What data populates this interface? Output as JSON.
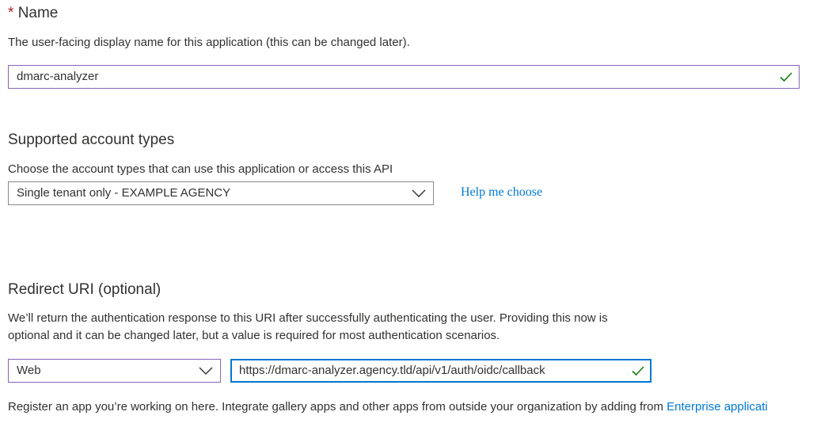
{
  "name_section": {
    "required_marker": "*",
    "heading": "Name",
    "description": "The user-facing display name for this application (this can be changed later).",
    "input_value": "dmarc-analyzer",
    "valid_icon": "check-icon"
  },
  "account_types": {
    "heading": "Supported account types",
    "description": "Choose the account types that can use this application or access this API",
    "selected": "Single tenant only - EXAMPLE AGENCY",
    "dropdown_icon": "chevron-down-icon",
    "help_link": "Help me choose"
  },
  "redirect_uri": {
    "heading": "Redirect URI (optional)",
    "description_line1": "We’ll return the authentication response to this URI after successfully authenticating the user. Providing this now is",
    "description_line2": "optional and it can be changed later, but a value is required for most authentication scenarios.",
    "platform_selected": "Web",
    "platform_icon": "chevron-down-icon",
    "uri_value": "https://dmarc-analyzer.agency.tld/api/v1/auth/oidc/callback",
    "valid_icon": "check-icon"
  },
  "footer": {
    "text": "Register an app you’re working on here. Integrate gallery apps and other apps from outside your organization by adding from",
    "link": "Enterprise applicati"
  },
  "colors": {
    "accent": "#0078d4",
    "purple_border": "#8764b8",
    "valid_green": "#107c10",
    "required_red": "#a4262c"
  }
}
